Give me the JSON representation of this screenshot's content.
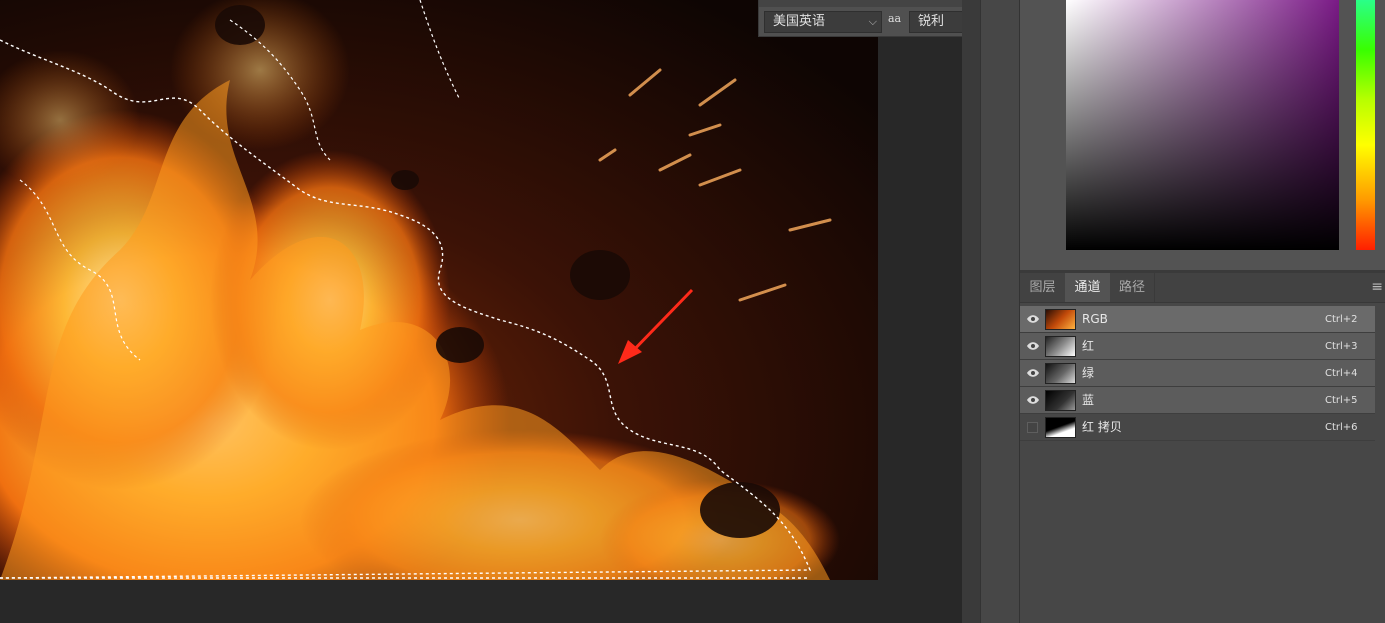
{
  "character_bar": {
    "language": "美国英语",
    "aa_icon": "aa",
    "antialias": "锐利"
  },
  "panel": {
    "tabs": [
      {
        "label": "图层",
        "active": false
      },
      {
        "label": "通道",
        "active": true
      },
      {
        "label": "路径",
        "active": false
      }
    ],
    "menu_icon": "menu-icon"
  },
  "channels": [
    {
      "name": "RGB",
      "shortcut": "Ctrl+2",
      "visible": true,
      "thumb": "color"
    },
    {
      "name": "红",
      "shortcut": "Ctrl+3",
      "visible": true,
      "thumb": "gray"
    },
    {
      "name": "绿",
      "shortcut": "Ctrl+4",
      "visible": true,
      "thumb": "gray"
    },
    {
      "name": "蓝",
      "shortcut": "Ctrl+5",
      "visible": true,
      "thumb": "dark"
    },
    {
      "name": "红 拷贝",
      "shortcut": "Ctrl+6",
      "visible": false,
      "thumb": "mask"
    }
  ],
  "colors": {
    "hue_selected": "#7a1a86",
    "annotation_arrow": "#ff2a1a"
  }
}
